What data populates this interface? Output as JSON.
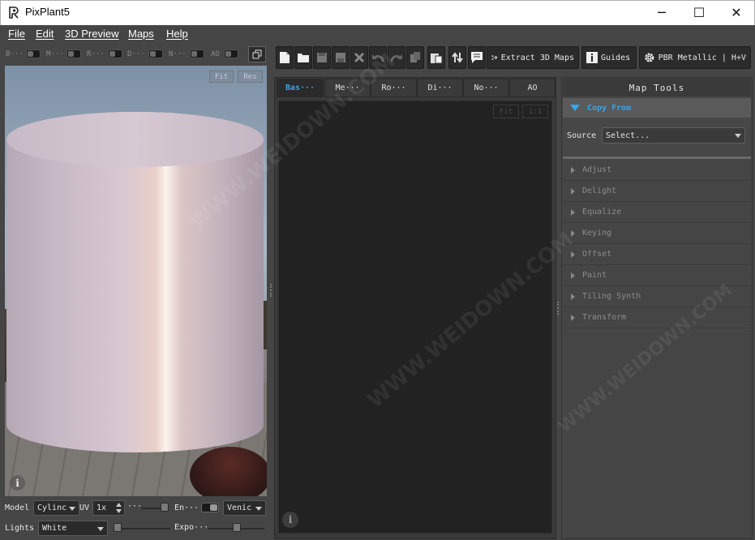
{
  "window": {
    "title": "PixPlant5",
    "minimize": "─",
    "maximize": "☐",
    "close": "✕"
  },
  "menu": {
    "file": "File",
    "edit": "Edit",
    "preview": "3D Preview",
    "maps": "Maps",
    "help": "Help"
  },
  "preview_toggles": [
    {
      "label": "B···"
    },
    {
      "label": "M···"
    },
    {
      "label": "R···"
    },
    {
      "label": "D···"
    },
    {
      "label": "N···"
    },
    {
      "label": "AO"
    }
  ],
  "viewport": {
    "fit_label": "Fit",
    "reset_label": "Res"
  },
  "toolbar": {
    "extract_label": "Extract 3D Maps",
    "guides_label": "Guides",
    "pbr_label": "PBR Metallic | H+V"
  },
  "tabs": [
    "Bas···",
    "Me···",
    "Ro···",
    "Di···",
    "No···",
    "AO"
  ],
  "canvas": {
    "fit_label": "Fit",
    "one_to_one_label": "1:1"
  },
  "map_tools": {
    "title": "Map Tools",
    "copy_from": "Copy From",
    "source_label": "Source",
    "source_value": "Select...",
    "items": [
      "Adjust",
      "Delight",
      "Equalize",
      "Keying",
      "Offset",
      "Paint",
      "Tiling Synth",
      "Transform"
    ]
  },
  "bottom": {
    "model_label": "Model",
    "model_value": "Cylinc",
    "uv_label": "UV",
    "uv_value": "1x",
    "dots_label": "···",
    "env_label": "En···",
    "env_value": "Venic",
    "lights_label": "Lights",
    "lights_value": "White",
    "expo_label": "Expo···"
  },
  "watermark": "WWW.WEIDOWN.COM",
  "colors": {
    "accent": "#38a5e6",
    "panel": "#454545",
    "canvas": "#222222"
  }
}
